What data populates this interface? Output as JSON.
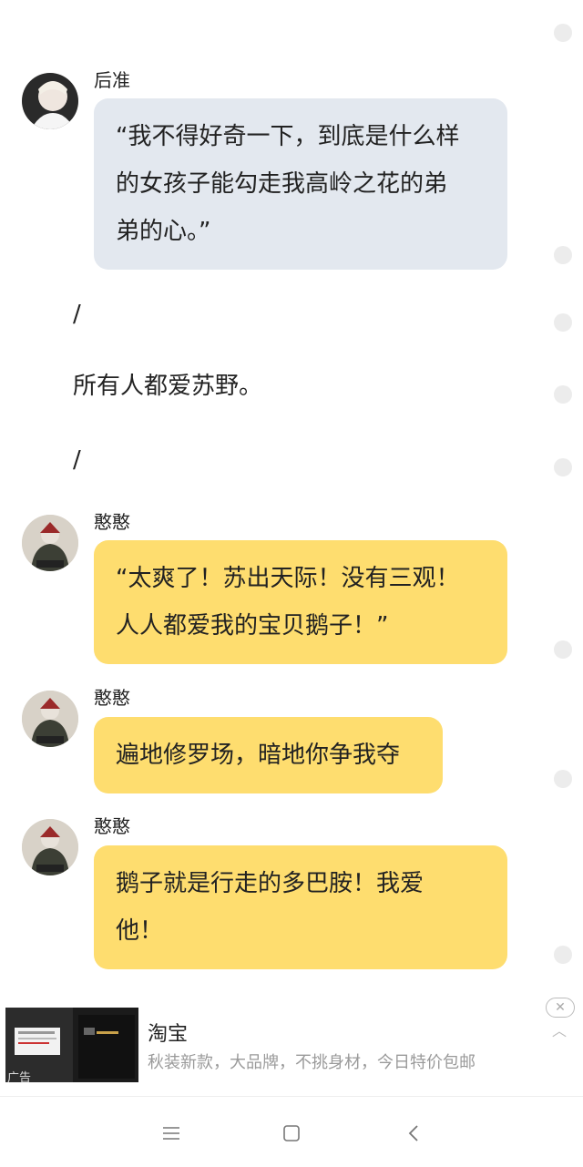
{
  "messages": [
    {
      "sender": "后准",
      "text": "“我不得好奇一下，到底是什么样的女孩子能勾走我高岭之花的弟弟的心。”",
      "lines": [
        "“我不得好奇一下，到底是什么样",
        "的女孩子能勾走我高岭之花的弟",
        "弟的心。”"
      ],
      "bubble": "gray"
    },
    {
      "sender": "憨憨",
      "lines": [
        "“太爽了！苏出天际！没有三观！",
        "人人都爱我的宝贝鹅子！”"
      ],
      "bubble": "yellow"
    },
    {
      "sender": "憨憨",
      "lines": [
        "遍地修罗场，暗地你争我夺"
      ],
      "bubble": "yellow"
    },
    {
      "sender": "憨憨",
      "lines": [
        "鹅子就是行走的多巴胺！我爱",
        "他！"
      ],
      "bubble": "yellow"
    }
  ],
  "narration": {
    "separator_1": "/",
    "line": "所有人都爱苏野。",
    "separator_2": "/"
  },
  "ad": {
    "title": "淘宝",
    "description": "秋装新款，大品牌，不挑身材，今日特价包邮",
    "label": "广告",
    "close_icon": "close-icon"
  },
  "navbar": {
    "icons": [
      "menu-icon",
      "home-icon",
      "back-icon"
    ]
  },
  "colors": {
    "gray_bubble": "#e3e8ef",
    "yellow_bubble": "#fedd6f"
  }
}
